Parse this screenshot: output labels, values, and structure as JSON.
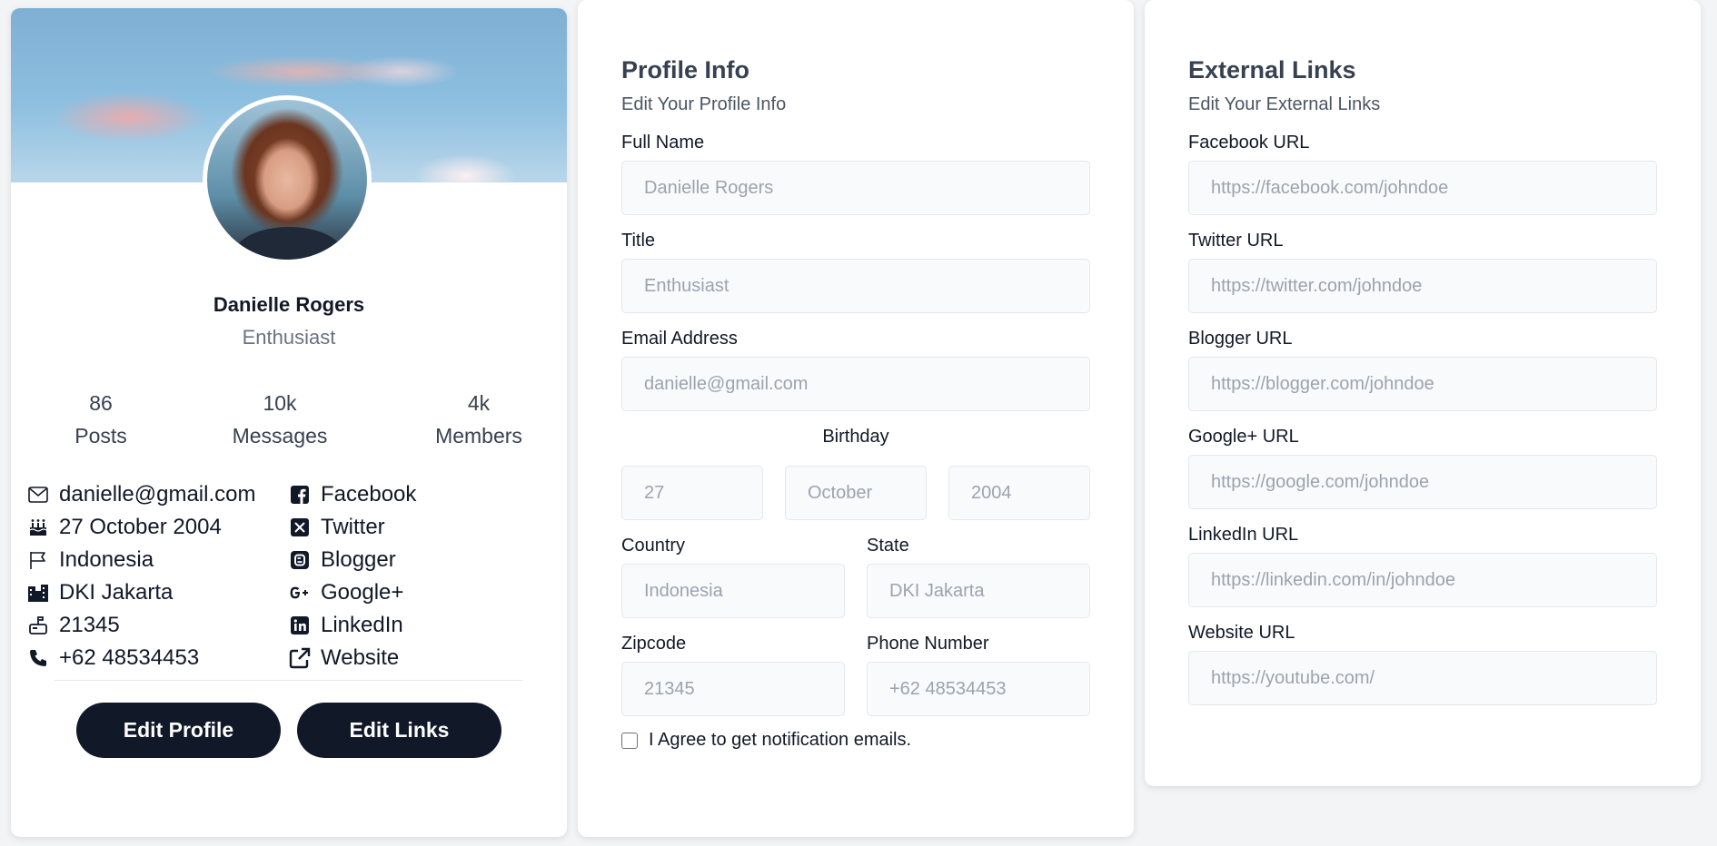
{
  "profile": {
    "name": "Danielle Rogers",
    "title": "Enthusiast",
    "stats": [
      {
        "value": "86",
        "label": "Posts"
      },
      {
        "value": "10k",
        "label": "Messages"
      },
      {
        "value": "4k",
        "label": "Members"
      }
    ],
    "info": [
      {
        "icon": "envelope-icon",
        "text": "danielle@gmail.com"
      },
      {
        "icon": "birthday-cake-icon",
        "text": "27 October 2004"
      },
      {
        "icon": "flag-icon",
        "text": "Indonesia"
      },
      {
        "icon": "city-icon",
        "text": "DKI Jakarta"
      },
      {
        "icon": "mailbox-icon",
        "text": "21345"
      },
      {
        "icon": "phone-icon",
        "text": "+62 48534453"
      }
    ],
    "links": [
      {
        "icon": "facebook-icon",
        "text": "Facebook"
      },
      {
        "icon": "twitter-x-icon",
        "text": "Twitter"
      },
      {
        "icon": "blogger-icon",
        "text": "Blogger"
      },
      {
        "icon": "google-plus-icon",
        "text": "Google+"
      },
      {
        "icon": "linkedin-icon",
        "text": "LinkedIn"
      },
      {
        "icon": "external-link-icon",
        "text": "Website"
      }
    ],
    "edit_profile_label": "Edit Profile",
    "edit_links_label": "Edit Links"
  },
  "profile_info": {
    "heading": "Profile Info",
    "subheading": "Edit Your Profile Info",
    "full_name": {
      "label": "Full Name",
      "placeholder": "Danielle Rogers"
    },
    "title": {
      "label": "Title",
      "placeholder": "Enthusiast"
    },
    "email": {
      "label": "Email Address",
      "placeholder": "danielle@gmail.com"
    },
    "birthday": {
      "label": "Birthday",
      "day": "27",
      "month": "October",
      "year": "2004"
    },
    "country": {
      "label": "Country",
      "placeholder": "Indonesia"
    },
    "state": {
      "label": "State",
      "placeholder": "DKI Jakarta"
    },
    "zipcode": {
      "label": "Zipcode",
      "placeholder": "21345"
    },
    "phone": {
      "label": "Phone Number",
      "placeholder": "+62 48534453"
    },
    "agree_label": "I Agree to get notification emails."
  },
  "external_links": {
    "heading": "External Links",
    "subheading": "Edit Your External Links",
    "fields": [
      {
        "label": "Facebook URL",
        "placeholder": "https://facebook.com/johndoe"
      },
      {
        "label": "Twitter URL",
        "placeholder": "https://twitter.com/johndoe"
      },
      {
        "label": "Blogger URL",
        "placeholder": "https://blogger.com/johndoe"
      },
      {
        "label": "Google+ URL",
        "placeholder": "https://google.com/johndoe"
      },
      {
        "label": "LinkedIn URL",
        "placeholder": "https://linkedin.com/in/johndoe"
      },
      {
        "label": "Website URL",
        "placeholder": "https://youtube.com/"
      }
    ]
  }
}
